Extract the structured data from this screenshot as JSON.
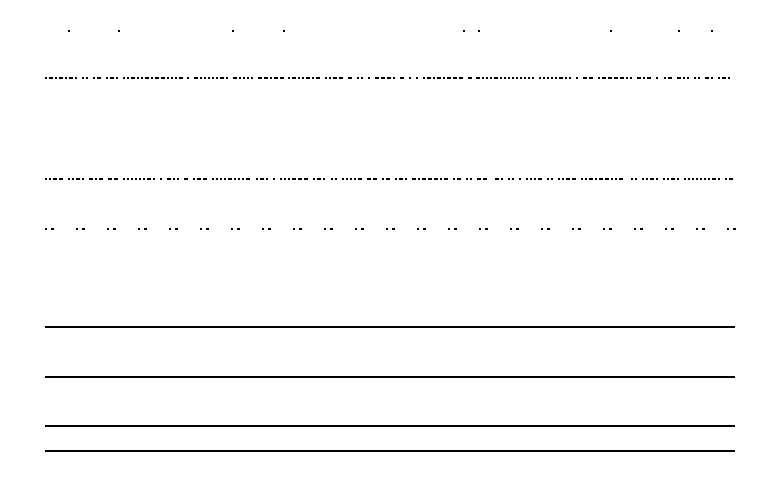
{
  "colors": {
    "background": "#ffffff",
    "ink": "#000000"
  }
}
